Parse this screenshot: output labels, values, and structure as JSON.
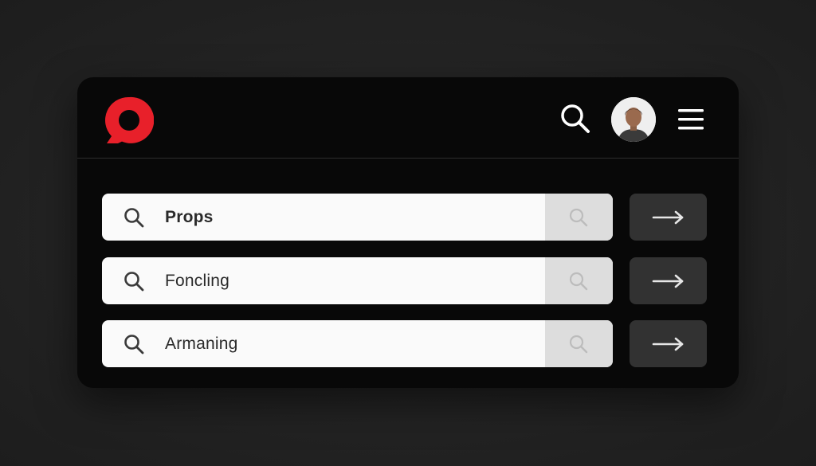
{
  "header": {
    "logo": {
      "icon": "brand-logo-icon",
      "color": "#e8202a"
    },
    "search_icon": "search-icon",
    "avatar_icon": "user-avatar",
    "menu_icon": "hamburger-menu-icon"
  },
  "search_rows": [
    {
      "value": "Props",
      "bold": true,
      "icon": "search-icon",
      "side_icon": "search-icon",
      "action_icon": "arrow-right-icon"
    },
    {
      "value": "Foncling",
      "bold": false,
      "icon": "search-icon",
      "side_icon": "search-icon",
      "action_icon": "arrow-right-icon"
    },
    {
      "value": "Armaning",
      "bold": false,
      "icon": "search-icon",
      "side_icon": "search-icon",
      "action_icon": "arrow-right-icon"
    }
  ],
  "colors": {
    "card_background": "#080808",
    "field_background": "#fafafa",
    "field_side_background": "#dddddd",
    "action_button_background": "#323232",
    "accent": "#e8202a"
  }
}
